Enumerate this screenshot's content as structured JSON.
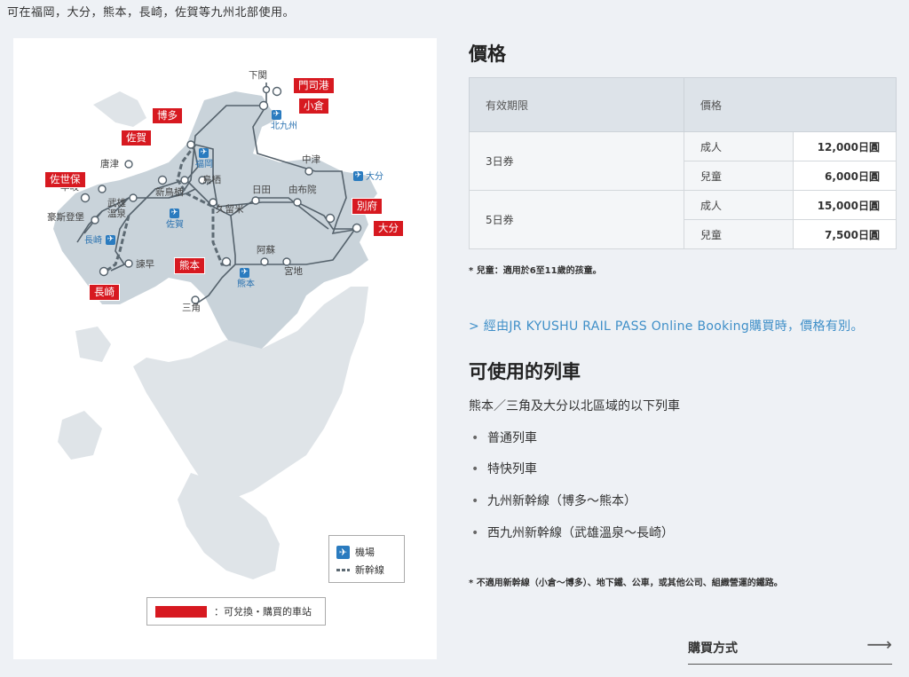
{
  "intro": "可在福岡，大分，熊本，長崎，佐賀等九州北部使用。",
  "map": {
    "stations": [
      "下関",
      "唐津",
      "早岐",
      "武雄溫泉",
      "豪斯登堡",
      "新鳥栖",
      "鳥栖",
      "久留米",
      "日田",
      "由布院",
      "中津",
      "阿蘇",
      "宮地",
      "三角",
      "諫早"
    ],
    "red_stations": [
      "門司港",
      "小倉",
      "博多",
      "佐賀",
      "佐世保",
      "別府",
      "大分",
      "熊本",
      "長崎"
    ],
    "airports": [
      "北九州",
      "福岡",
      "大分",
      "佐賀",
      "長崎",
      "熊本"
    ],
    "legend": {
      "airport": "機場",
      "shinkansen": "新幹線",
      "red_note": "：可兌換・購買的車站"
    }
  },
  "price": {
    "title": "價格",
    "col_period": "有效期限",
    "col_price": "價格",
    "rows": [
      {
        "period": "3日券",
        "adult_label": "成人",
        "adult": "12,000日圓",
        "child_label": "兒童",
        "child": "6,000日圓"
      },
      {
        "period": "5日券",
        "adult_label": "成人",
        "adult": "15,000日圓",
        "child_label": "兒童",
        "child": "7,500日圓"
      }
    ],
    "note": "* 兒童：適用於6至11歲的孩童。"
  },
  "link": "> 經由JR KYUSHU RAIL PASS Online Booking購買時，價格有別。",
  "trains": {
    "title": "可使用的列車",
    "desc": "熊本／三角及大分以北區域的以下列車",
    "items": [
      "普通列車",
      "特快列車",
      "九州新幹線（博多～熊本）",
      "西九州新幹線（武雄溫泉～長崎）"
    ],
    "note": "* 不適用新幹線（小倉～博多）、地下鐵、公車，或其他公司、組織營運的鐵路。"
  },
  "buy": {
    "label": "購買方式",
    "arrow": "⟶"
  }
}
